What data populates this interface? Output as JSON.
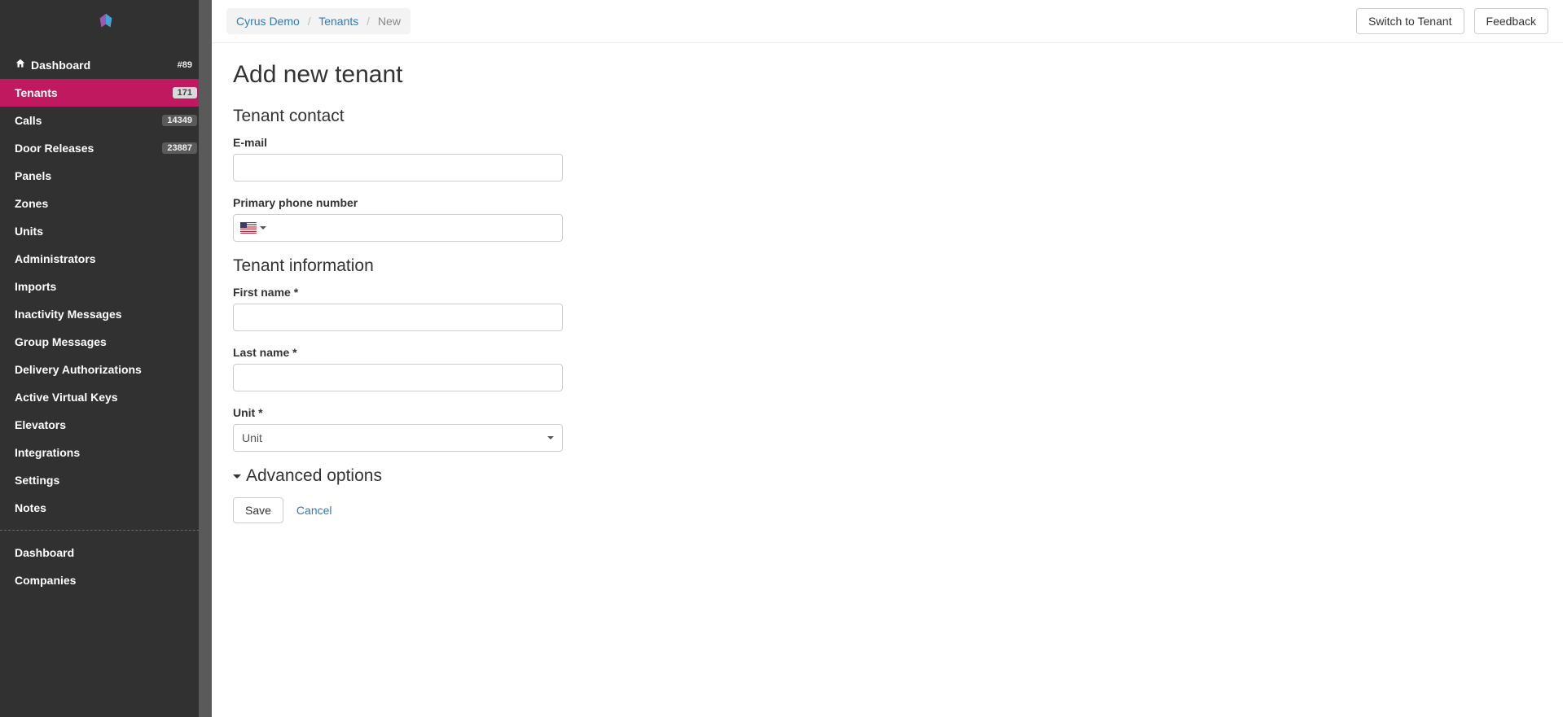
{
  "sidebar": {
    "items": [
      {
        "label": "Dashboard",
        "badge": "#89",
        "icon": "home"
      },
      {
        "label": "Tenants",
        "badge": "171",
        "active": true
      },
      {
        "label": "Calls",
        "badge": "14349"
      },
      {
        "label": "Door Releases",
        "badge": "23887"
      },
      {
        "label": "Panels"
      },
      {
        "label": "Zones"
      },
      {
        "label": "Units"
      },
      {
        "label": "Administrators"
      },
      {
        "label": "Imports"
      },
      {
        "label": "Inactivity Messages"
      },
      {
        "label": "Group Messages"
      },
      {
        "label": "Delivery Authorizations"
      },
      {
        "label": "Active Virtual Keys"
      },
      {
        "label": "Elevators"
      },
      {
        "label": "Integrations"
      },
      {
        "label": "Settings"
      },
      {
        "label": "Notes"
      }
    ],
    "secondary": [
      {
        "label": "Dashboard"
      },
      {
        "label": "Companies"
      }
    ]
  },
  "breadcrumbs": {
    "root": "Cyrus Demo",
    "parent": "Tenants",
    "current": "New"
  },
  "top_buttons": {
    "switch": "Switch to Tenant",
    "feedback": "Feedback"
  },
  "page": {
    "title": "Add new tenant",
    "section_contact": "Tenant contact",
    "section_info": "Tenant information",
    "email_label": "E-mail",
    "phone_label": "Primary phone number",
    "first_name_label": "First name *",
    "last_name_label": "Last name *",
    "unit_label": "Unit *",
    "unit_placeholder": "Unit",
    "advanced": "Advanced options",
    "save": "Save",
    "cancel": "Cancel"
  }
}
